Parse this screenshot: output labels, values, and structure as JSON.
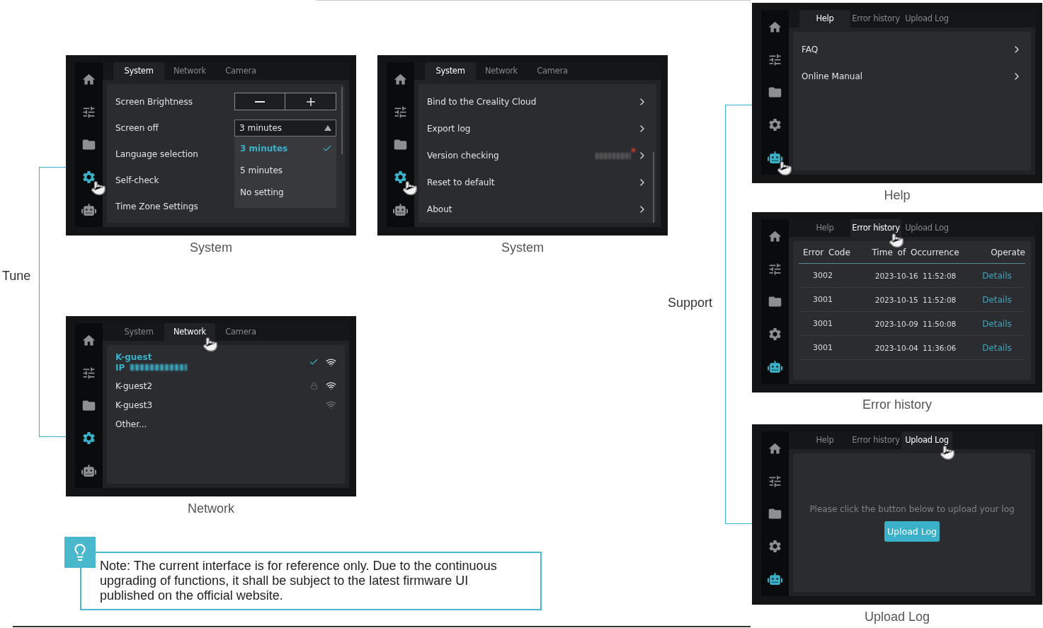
{
  "tune_label": "Tune",
  "tune_screens": [
    {
      "caption": "System",
      "tabs": [
        {
          "label": "System",
          "selected": true,
          "touched": false
        },
        {
          "label": "Network",
          "selected": false,
          "touched": false
        },
        {
          "label": "Camera",
          "selected": false,
          "touched": false
        }
      ],
      "nav": [
        {
          "selected": false,
          "touched": false
        },
        {
          "selected": false,
          "touched": false
        },
        {
          "selected": false,
          "touched": false
        },
        {
          "selected": true,
          "touched": true
        },
        {
          "selected": false,
          "touched": false
        }
      ],
      "content": {
        "kind": "settings",
        "rows": [
          {
            "kind": "stepper",
            "label": "Screen Brightness"
          },
          {
            "kind": "dropdown",
            "label": "Screen off",
            "value": "3 minutes",
            "expanded": true,
            "options": [
              {
                "label": "3 minutes",
                "selected": true
              },
              {
                "label": "5 minutes",
                "selected": false
              },
              {
                "label": "No setting",
                "selected": false
              }
            ]
          },
          {
            "kind": "plain",
            "label": "Language selection"
          },
          {
            "kind": "plain",
            "label": "Self-check"
          },
          {
            "kind": "plain",
            "label": "Time Zone Settings"
          }
        ]
      }
    },
    {
      "caption": "System",
      "tabs": [
        {
          "label": "System",
          "selected": true,
          "touched": false
        },
        {
          "label": "Network",
          "selected": false,
          "touched": false
        },
        {
          "label": "Camera",
          "selected": false,
          "touched": false
        }
      ],
      "nav": [
        {
          "selected": false,
          "touched": false
        },
        {
          "selected": false,
          "touched": false
        },
        {
          "selected": false,
          "touched": false
        },
        {
          "selected": true,
          "touched": true
        },
        {
          "selected": false,
          "touched": false
        }
      ],
      "content": {
        "kind": "menu",
        "items": [
          {
            "kind": "link",
            "label": "Bind to the Creality Cloud"
          },
          {
            "kind": "link",
            "label": "Export log"
          },
          {
            "kind": "version",
            "label": "Version checking",
            "update_available": true
          },
          {
            "kind": "link",
            "label": "Reset to default"
          },
          {
            "kind": "link",
            "label": "About"
          }
        ]
      }
    },
    {
      "caption": "Network",
      "tabs": [
        {
          "label": "System",
          "selected": false,
          "touched": false
        },
        {
          "label": "Network",
          "selected": true,
          "touched": true
        },
        {
          "label": "Camera",
          "selected": false,
          "touched": false
        }
      ],
      "nav": [
        {
          "selected": false,
          "touched": false
        },
        {
          "selected": false,
          "touched": false
        },
        {
          "selected": false,
          "touched": false
        },
        {
          "selected": true,
          "touched": false
        },
        {
          "selected": false,
          "touched": false
        }
      ],
      "content": {
        "kind": "wifi",
        "networks": [
          {
            "name": "K-guest",
            "connected": true,
            "ip_label": "IP",
            "locked": false,
            "weak_signal": false
          },
          {
            "name": "K-guest2",
            "connected": false,
            "locked": true,
            "weak_signal": false
          },
          {
            "name": "K-guest3",
            "connected": false,
            "locked": false,
            "weak_signal": true
          }
        ],
        "other": "Other..."
      }
    }
  ],
  "support_label": "Support",
  "support_screens": [
    {
      "caption": "Help",
      "tabs": [
        {
          "label": "Help",
          "selected": true,
          "touched": false
        },
        {
          "label": "Error history",
          "selected": false,
          "touched": false
        },
        {
          "label": "Upload Log",
          "selected": false,
          "touched": false
        }
      ],
      "nav": [
        {
          "selected": false,
          "touched": false
        },
        {
          "selected": false,
          "touched": false
        },
        {
          "selected": false,
          "touched": false
        },
        {
          "selected": false,
          "touched": false
        },
        {
          "selected": true,
          "touched": true
        }
      ],
      "content": {
        "kind": "menu",
        "items": [
          {
            "kind": "link",
            "label": "FAQ"
          },
          {
            "kind": "link",
            "label": "Online Manual"
          }
        ]
      }
    },
    {
      "caption": "Error history",
      "tabs": [
        {
          "label": "Help",
          "selected": false,
          "touched": false
        },
        {
          "label": "Error history",
          "selected": true,
          "touched": true
        },
        {
          "label": "Upload Log",
          "selected": false,
          "touched": false
        }
      ],
      "nav": [
        {
          "selected": false,
          "touched": false
        },
        {
          "selected": false,
          "touched": false
        },
        {
          "selected": false,
          "touched": false
        },
        {
          "selected": false,
          "touched": false
        },
        {
          "selected": true,
          "touched": false
        }
      ],
      "content": {
        "kind": "table",
        "columns": [
          "Error Code",
          "Time of Occurrence",
          "Operate"
        ],
        "rows": [
          [
            "3002",
            "2023-10-16 11:52:08",
            "Details"
          ],
          [
            "3001",
            "2023-10-15 11:52:08",
            "Details"
          ],
          [
            "3001",
            "2023-10-09 11:50:08",
            "Details"
          ],
          [
            "3001",
            "2023-10-04 11:36:06",
            "Details"
          ]
        ]
      }
    },
    {
      "caption": "Upload Log",
      "tabs": [
        {
          "label": "Help",
          "selected": false,
          "touched": false
        },
        {
          "label": "Error history",
          "selected": false,
          "touched": false
        },
        {
          "label": "Upload Log",
          "selected": true,
          "touched": true
        }
      ],
      "nav": [
        {
          "selected": false,
          "touched": false
        },
        {
          "selected": false,
          "touched": false
        },
        {
          "selected": false,
          "touched": false
        },
        {
          "selected": false,
          "touched": false
        },
        {
          "selected": true,
          "touched": false
        }
      ],
      "content": {
        "kind": "upload",
        "message": "Please click the button below to upload your log",
        "button": "Upload Log"
      }
    }
  ],
  "note": {
    "text": "Note: The current interface is for reference only. Due to the continuous upgrading of functions, it shall be subject to the latest firmware UI published on the official website."
  }
}
